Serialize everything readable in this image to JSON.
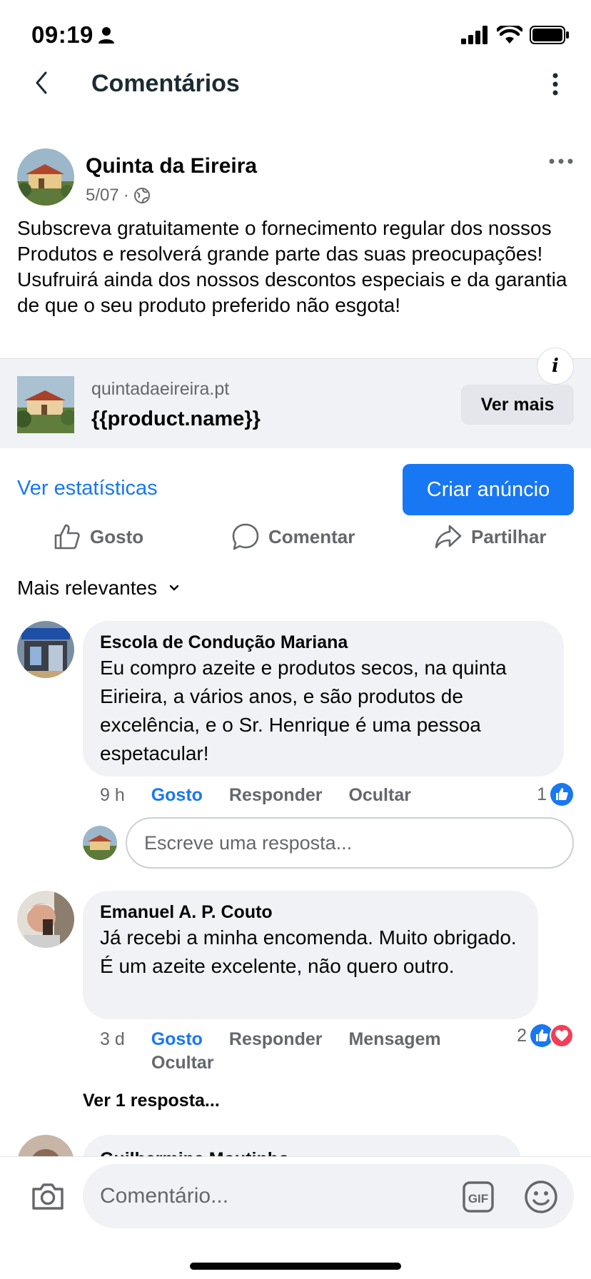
{
  "status_bar": {
    "time": "09:19"
  },
  "header": {
    "title": "Comentários"
  },
  "post": {
    "author": "Quinta da Eireira",
    "date": "5/07",
    "separator": "·",
    "text": "Subscreva gratuitamente o fornecimento regular dos nossos Produtos e resolverá grande parte das suas preocupações! Usufruirá ainda dos nossos descontos especiais e da garantia de que o seu produto preferido não esgota!",
    "link": {
      "domain": "quintadaeireira.pt",
      "title": "{{product.name}}",
      "button_label": "Ver mais",
      "info_label": "i"
    }
  },
  "stats_link": "Ver estatísticas",
  "create_ad_button": "Criar anúncio",
  "actions": {
    "like": "Gosto",
    "comment": "Comentar",
    "share": "Partilhar"
  },
  "sort": {
    "label": "Mais relevantes"
  },
  "comments": [
    {
      "author": "Escola de Condução Mariana",
      "text": "Eu compro azeite e produtos secos, na quinta Eirieira, a vários anos, e são produtos de excelência, e o Sr. Henrique é uma pessoa espetacular!",
      "time": "9 h",
      "like_label": "Gosto",
      "reply_label": "Responder",
      "hide_label": "Ocultar",
      "reaction_count": "1"
    },
    {
      "author": "Emanuel A. P. Couto",
      "text": "Já recebi a minha encomenda. Muito obrigado. É um azeite excelente, não quero outro.",
      "time": "3 d",
      "like_label": "Gosto",
      "reply_label": "Responder",
      "message_label": "Mensagem",
      "hide_label": "Ocultar",
      "reaction_count": "2"
    },
    {
      "author": "Guilhermina Moutinho"
    }
  ],
  "reply_input": {
    "placeholder": "Escreve uma resposta..."
  },
  "view_replies": "Ver 1 resposta...",
  "composer": {
    "placeholder": "Comentário...",
    "gif_label": "GIF"
  },
  "icons": {
    "back": "chevron-left-icon",
    "menu": "kebab-icon",
    "globe": "globe-icon",
    "like": "thumbs-up-icon",
    "comment": "speech-bubble-icon",
    "share": "share-arrow-icon",
    "camera": "camera-icon",
    "emoji": "smiley-icon"
  },
  "colors": {
    "accent": "#1877f2",
    "love": "#f33e58",
    "bubble": "#f0f2f5",
    "secondary_text": "#65676b"
  }
}
